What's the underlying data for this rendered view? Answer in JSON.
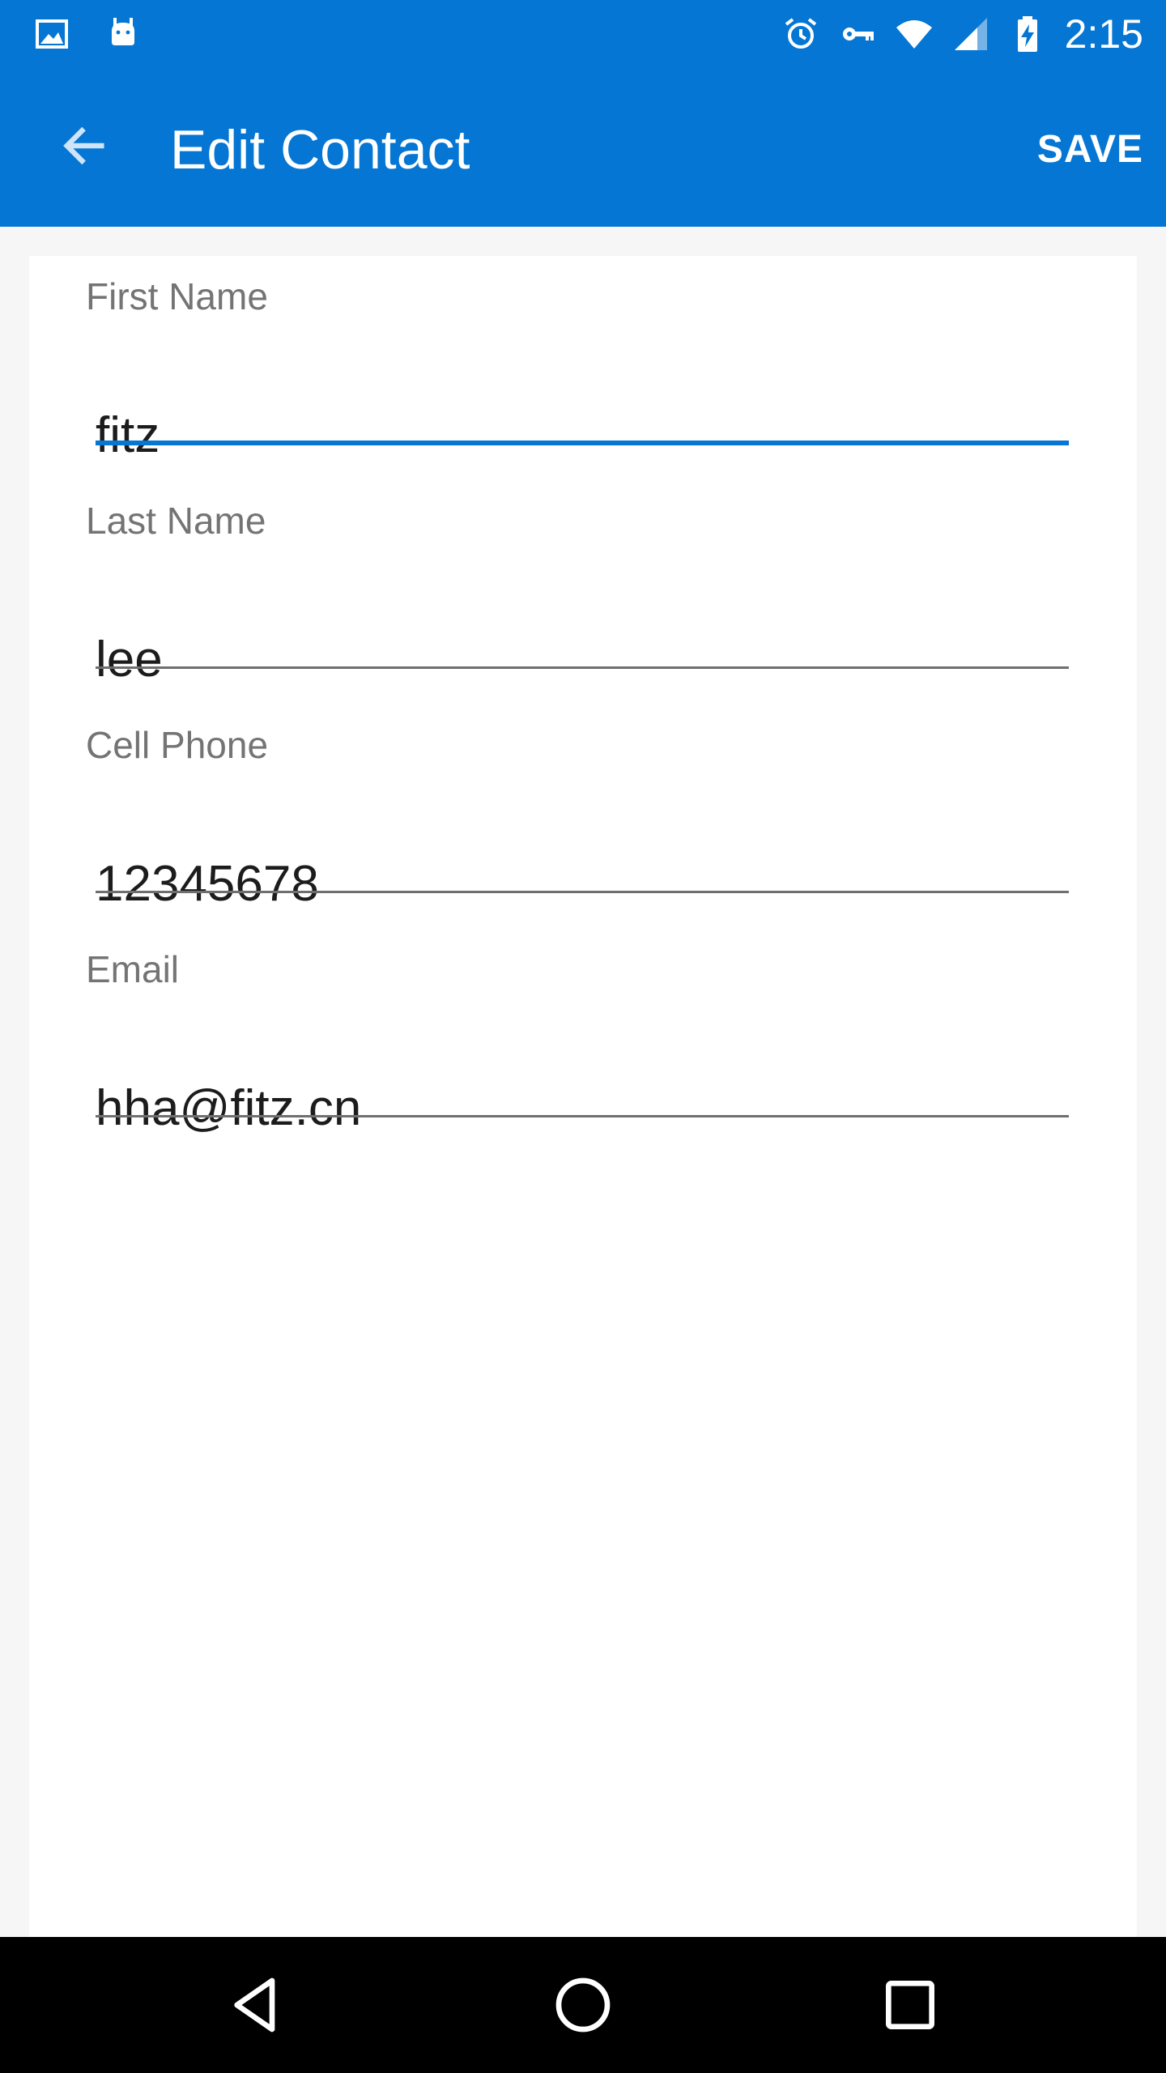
{
  "status_bar": {
    "time": "2:15",
    "left_icons": [
      "image-icon",
      "android-icon"
    ],
    "right_icons": [
      "alarm-icon",
      "vpn-key-icon",
      "wifi-icon",
      "cell-signal-icon",
      "battery-charging-icon"
    ]
  },
  "app_bar": {
    "title": "Edit Contact",
    "save_label": "SAVE",
    "back_icon": "arrow-back-icon"
  },
  "form": {
    "fields": [
      {
        "label": "First Name",
        "value": "fitz",
        "focused": true
      },
      {
        "label": "Last Name",
        "value": "lee",
        "focused": false
      },
      {
        "label": "Cell Phone",
        "value": "12345678",
        "focused": false
      },
      {
        "label": "Email",
        "value": "hha@fitz.cn",
        "focused": false
      }
    ]
  },
  "nav_bar": {
    "icons": [
      "back-triangle-icon",
      "home-circle-icon",
      "recents-square-icon"
    ]
  },
  "colors": {
    "primary": "#0576d3",
    "background": "#f6f6f6",
    "card": "#ffffff",
    "label": "#747474",
    "text": "#1c1c1c"
  }
}
